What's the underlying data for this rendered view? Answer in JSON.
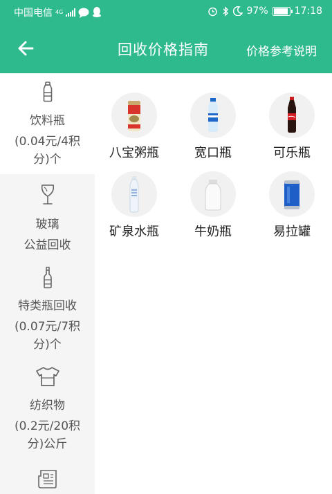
{
  "status_bar": {
    "carrier": "中国电信",
    "network": "4G",
    "battery": "97%",
    "battery_level": 0.97,
    "time": "17:18"
  },
  "app_bar": {
    "title": "回收价格指南",
    "action": "价格参考说明"
  },
  "sidebar": {
    "categories": [
      {
        "icon": "plastic-bottle-icon",
        "lines": [
          "饮料瓶",
          "(0.04元/4积",
          "分)个"
        ],
        "active": true
      },
      {
        "icon": "wine-glass-icon",
        "lines": [
          "玻璃",
          "公益回收"
        ],
        "active": false
      },
      {
        "icon": "glass-bottle-icon",
        "lines": [
          "特类瓶回收",
          "(0.07元/7积",
          "分)个"
        ],
        "active": false
      },
      {
        "icon": "tshirt-icon",
        "lines": [
          "纺织物",
          "(0.2元/20积",
          "分)公斤"
        ],
        "active": false
      },
      {
        "icon": "newspaper-icon",
        "lines": [],
        "active": false
      }
    ]
  },
  "items": [
    {
      "name": "八宝粥瓶",
      "icon": "congee-can-icon"
    },
    {
      "name": "宽口瓶",
      "icon": "water-bottle-icon"
    },
    {
      "name": "可乐瓶",
      "icon": "cola-bottle-icon"
    },
    {
      "name": "矿泉水瓶",
      "icon": "mineral-water-bottle-icon"
    },
    {
      "name": "牛奶瓶",
      "icon": "milk-bottle-icon"
    },
    {
      "name": "易拉罐",
      "icon": "soda-can-icon"
    }
  ],
  "colors": {
    "accent": "#2fba8e",
    "sidebar_bg": "#f5f5f5",
    "text": "#222222",
    "muted": "#555555"
  }
}
